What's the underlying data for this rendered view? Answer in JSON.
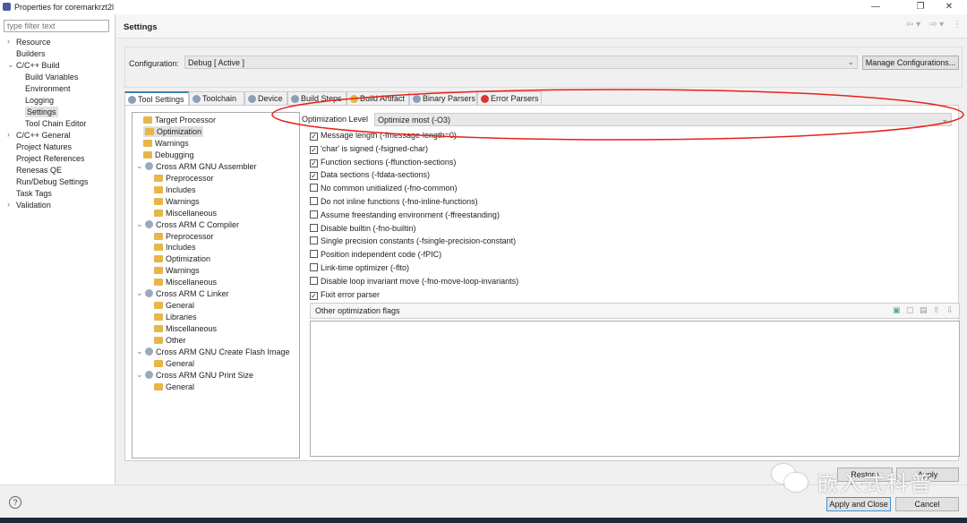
{
  "window": {
    "title": "Properties for coremarkrzt2l",
    "minimize": "—",
    "restore": "❐",
    "close": "✕"
  },
  "sidebar": {
    "filter_placeholder": "type filter text",
    "items": [
      {
        "label": "Resource",
        "level": 0,
        "chevron": "›"
      },
      {
        "label": "Builders",
        "level": 0
      },
      {
        "label": "C/C++ Build",
        "level": 0,
        "chevron": "⌄"
      },
      {
        "label": "Build Variables",
        "level": 1
      },
      {
        "label": "Environment",
        "level": 1
      },
      {
        "label": "Logging",
        "level": 1
      },
      {
        "label": "Settings",
        "level": 1,
        "selected": true
      },
      {
        "label": "Tool Chain Editor",
        "level": 1
      },
      {
        "label": "C/C++ General",
        "level": 0,
        "chevron": "›"
      },
      {
        "label": "Project Natures",
        "level": 0
      },
      {
        "label": "Project References",
        "level": 0
      },
      {
        "label": "Renesas QE",
        "level": 0
      },
      {
        "label": "Run/Debug Settings",
        "level": 0
      },
      {
        "label": "Task Tags",
        "level": 0
      },
      {
        "label": "Validation",
        "level": 0,
        "chevron": "›"
      }
    ]
  },
  "header": {
    "title": "Settings",
    "nav_back": "⇦ ▾",
    "nav_forward": "⇨ ▾",
    "menu": "⋮"
  },
  "configuration": {
    "label": "Configuration:",
    "value": "Debug  [ Active ]",
    "manage_button": "Manage Configurations..."
  },
  "tabs": [
    {
      "label": "Tool Settings",
      "active": true
    },
    {
      "label": "Toolchain"
    },
    {
      "label": "Device"
    },
    {
      "label": "Build Steps"
    },
    {
      "label": "Build Artifact"
    },
    {
      "label": "Binary Parsers"
    },
    {
      "label": "Error Parsers"
    }
  ],
  "tool_tree": [
    {
      "label": "Target Processor",
      "level": 0,
      "icon": "folder-gear"
    },
    {
      "label": "Optimization",
      "level": 0,
      "icon": "folder-gear",
      "selected": true
    },
    {
      "label": "Warnings",
      "level": 0,
      "icon": "folder-gear"
    },
    {
      "label": "Debugging",
      "level": 0,
      "icon": "folder-gear"
    },
    {
      "label": "Cross ARM GNU Assembler",
      "level": -1,
      "icon": "gear",
      "chevron": "⌄"
    },
    {
      "label": "Preprocessor",
      "level": 1,
      "icon": "folder-gear"
    },
    {
      "label": "Includes",
      "level": 1,
      "icon": "folder-gear"
    },
    {
      "label": "Warnings",
      "level": 1,
      "icon": "folder-gear"
    },
    {
      "label": "Miscellaneous",
      "level": 1,
      "icon": "folder-gear"
    },
    {
      "label": "Cross ARM C Compiler",
      "level": -1,
      "icon": "gear",
      "chevron": "⌄"
    },
    {
      "label": "Preprocessor",
      "level": 1,
      "icon": "folder-gear"
    },
    {
      "label": "Includes",
      "level": 1,
      "icon": "folder-gear"
    },
    {
      "label": "Optimization",
      "level": 1,
      "icon": "folder-gear"
    },
    {
      "label": "Warnings",
      "level": 1,
      "icon": "folder-gear"
    },
    {
      "label": "Miscellaneous",
      "level": 1,
      "icon": "folder-gear"
    },
    {
      "label": "Cross ARM C Linker",
      "level": -1,
      "icon": "gear",
      "chevron": "⌄"
    },
    {
      "label": "General",
      "level": 1,
      "icon": "folder-gear"
    },
    {
      "label": "Libraries",
      "level": 1,
      "icon": "folder-gear"
    },
    {
      "label": "Miscellaneous",
      "level": 1,
      "icon": "folder-gear"
    },
    {
      "label": "Other",
      "level": 1,
      "icon": "folder-gear"
    },
    {
      "label": "Cross ARM GNU Create Flash Image",
      "level": -1,
      "icon": "gear",
      "chevron": "⌄"
    },
    {
      "label": "General",
      "level": 1,
      "icon": "folder-gear"
    },
    {
      "label": "Cross ARM GNU Print Size",
      "level": -1,
      "icon": "gear",
      "chevron": "⌄"
    },
    {
      "label": "General",
      "level": 1,
      "icon": "folder-gear"
    }
  ],
  "optimization": {
    "level_label": "Optimization Level",
    "level_value": "Optimize most (-O3)",
    "options": [
      {
        "label": "Message length (-fmessage-length=0)",
        "checked": true
      },
      {
        "label": "'char' is signed (-fsigned-char)",
        "checked": true
      },
      {
        "label": "Function sections (-ffunction-sections)",
        "checked": true
      },
      {
        "label": "Data sections (-fdata-sections)",
        "checked": true
      },
      {
        "label": "No common unitialized (-fno-common)",
        "checked": false
      },
      {
        "label": "Do not inline functions (-fno-inline-functions)",
        "checked": false
      },
      {
        "label": "Assume freestanding environment (-ffreestanding)",
        "checked": false
      },
      {
        "label": "Disable builtin (-fno-builtin)",
        "checked": false
      },
      {
        "label": "Single precision constants (-fsingle-precision-constant)",
        "checked": false
      },
      {
        "label": "Position independent code (-fPIC)",
        "checked": false
      },
      {
        "label": "Link-time optimizer (-flto)",
        "checked": false
      },
      {
        "label": "Disable loop invariant move (-fno-move-loop-invariants)",
        "checked": false
      },
      {
        "label": "Fixit error parser",
        "checked": true
      }
    ],
    "other_flags_label": "Other optimization flags"
  },
  "buttons": {
    "restore_defaults": "Restore Defaults",
    "apply": "Apply",
    "apply_and_close": "Apply and Close",
    "cancel": "Cancel",
    "help": "?"
  },
  "watermark": "嵌入式科普",
  "colors": {
    "annotation": "#e8201a",
    "tab_accent": "#3c7fb1",
    "default_button_border": "#3c8fd8"
  }
}
